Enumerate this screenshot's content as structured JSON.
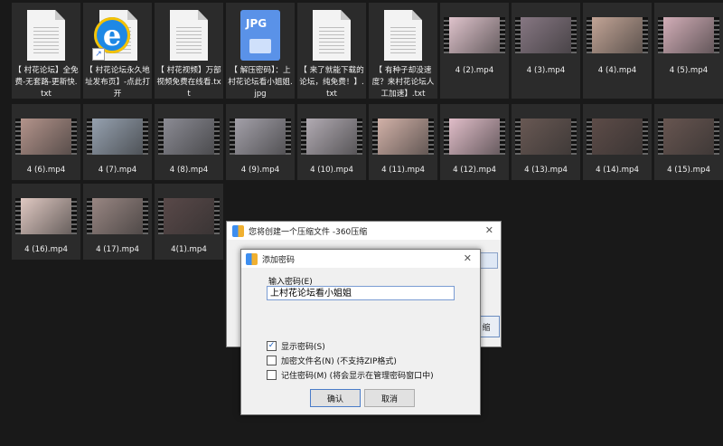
{
  "files": [
    {
      "name": "【 村花论坛】全免费-无套路-更新快.txt",
      "type": "txt"
    },
    {
      "name": "【 村花论坛永久地址发布页】-点此打开",
      "type": "ie"
    },
    {
      "name": "【 村花视频】万部视频免费在线看.txt",
      "type": "txt"
    },
    {
      "name": "【 解压密码】：上村花论坛看小姐姐.jpg",
      "type": "jpg"
    },
    {
      "name": "【 来了就能下载的论坛，纯免费！】.txt",
      "type": "txt"
    },
    {
      "name": "【 有种子却没速度？来村花论坛人工加速】.txt",
      "type": "txt"
    },
    {
      "name": "4 (2).mp4",
      "type": "video",
      "color": "#e6c9d2"
    },
    {
      "name": "4 (3).mp4",
      "type": "video",
      "color": "#8a7a86"
    },
    {
      "name": "4 (4).mp4",
      "type": "video",
      "color": "#c8a99a"
    },
    {
      "name": "4 (5).mp4",
      "type": "video",
      "color": "#d9b3bd"
    },
    {
      "name": "4 (6).mp4",
      "type": "video",
      "color": "#b9988f"
    },
    {
      "name": "4 (7).mp4",
      "type": "video",
      "color": "#9aa6b5"
    },
    {
      "name": "4 (8).mp4",
      "type": "video",
      "color": "#8f8f98"
    },
    {
      "name": "4 (9).mp4",
      "type": "video",
      "color": "#a8a5ae"
    },
    {
      "name": "4 (10).mp4",
      "type": "video",
      "color": "#b7b0b8"
    },
    {
      "name": "4 (11).mp4",
      "type": "video",
      "color": "#d9b7ad"
    },
    {
      "name": "4 (12).mp4",
      "type": "video",
      "color": "#e8c3cf"
    },
    {
      "name": "4 (13).mp4",
      "type": "video",
      "color": "#6b5a55"
    },
    {
      "name": "4 (14).mp4",
      "type": "video",
      "color": "#5f4d49"
    },
    {
      "name": "4 (15).mp4",
      "type": "video",
      "color": "#6a5752"
    },
    {
      "name": "4 (16).mp4",
      "type": "video",
      "color": "#e7cfc8"
    },
    {
      "name": "4 (17).mp4",
      "type": "video",
      "color": "#9d8a86"
    },
    {
      "name": "4(1).mp4",
      "type": "video",
      "color": "#5b4a4a"
    }
  ],
  "back_dialog": {
    "title": "您将创建一个压缩文件 -360压缩",
    "close": "✕",
    "button_fragment": "缩"
  },
  "password_dialog": {
    "title": "添加密码",
    "close": "✕",
    "field_label": "输入密码(E)",
    "password_value": "上村花论坛看小姐姐",
    "options": [
      {
        "label": "显示密码(S)",
        "checked": true
      },
      {
        "label": "加密文件名(N) (不支持ZIP格式)",
        "checked": false
      },
      {
        "label": "记住密码(M) (将会显示在管理密码窗口中)",
        "checked": false
      }
    ],
    "ok_label": "确认",
    "cancel_label": "取消"
  }
}
